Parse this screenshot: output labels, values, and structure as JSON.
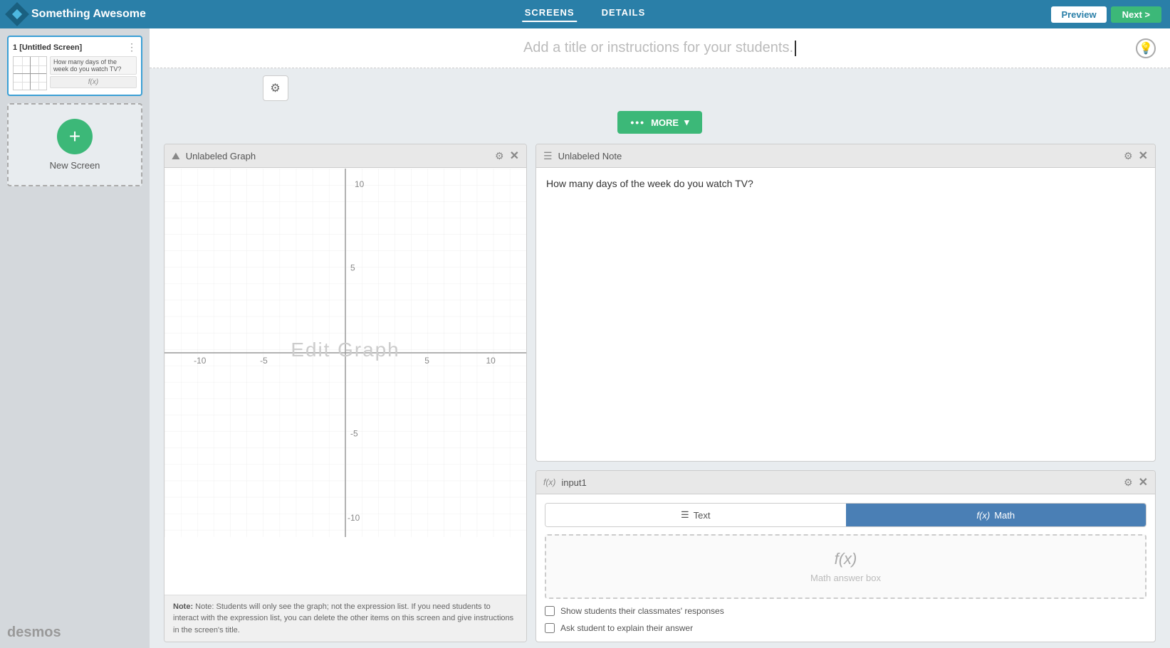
{
  "app": {
    "name": "Something Awesome"
  },
  "nav": {
    "screens_label": "SCREENS",
    "details_label": "DETAILS",
    "preview_label": "Preview",
    "next_label": "Next >"
  },
  "sidebar": {
    "screen_number": "1",
    "screen_title": "[Untitled Screen]",
    "screen_note": "How many days of the week do you watch TV?",
    "screen_input": "f(x)",
    "new_screen_label": "New Screen",
    "desmos_label": "desmos"
  },
  "main": {
    "title_placeholder": "Add a title or instructions for your students.",
    "more_label": "MORE",
    "more_dots": "•••"
  },
  "graph_panel": {
    "icon": "📈",
    "title": "Unlabeled Graph",
    "edit_overlay": "Edit Graph",
    "note": "Note: Students will only see the graph; not the expression list. If you need students to interact with the expression list, you can delete the other items on this screen and give instructions in the screen's title.",
    "x_min": "-10",
    "x_max": "10",
    "y_min": "-10",
    "y_max": "10",
    "x_mid_neg": "-5",
    "x_mid_pos": "5",
    "y_mid_neg": "-5",
    "y_mid_pos": "5"
  },
  "note_panel": {
    "icon": "📝",
    "title": "Unlabeled Note",
    "content": "How many days of the week do you watch TV?"
  },
  "input_panel": {
    "icon": "f(x)",
    "title": "input1",
    "text_tab_label": "Text",
    "math_tab_label": "Math",
    "math_fx": "f(x)",
    "math_box_label": "Math answer box",
    "checkbox1": "Show students their classmates' responses",
    "checkbox2": "Ask student to explain their answer"
  }
}
